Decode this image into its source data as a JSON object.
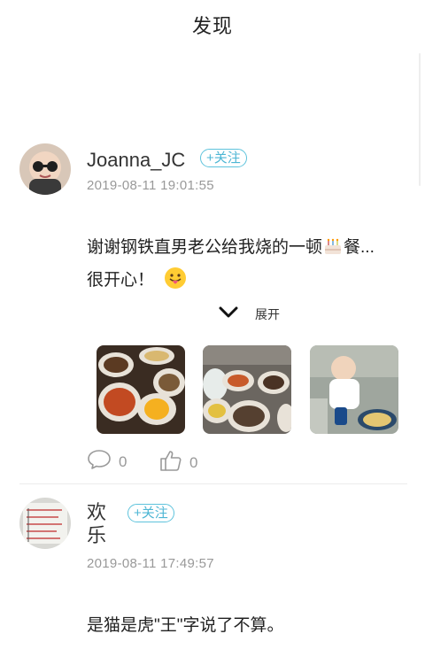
{
  "header": {
    "title": "发现"
  },
  "posts": [
    {
      "username": "Joanna_JC",
      "follow_label": "+关注",
      "timestamp": "2019-08-11 19:01:55",
      "content_line1": "谢谢钢铁直男老公给我烧的一顿",
      "content_line1_tail": "餐...",
      "content_line2": "很开心！",
      "expand_label": "展开",
      "comment_count": "0",
      "like_count": "0"
    },
    {
      "username_line1": "欢",
      "username_line2": "乐",
      "follow_label": "+关注",
      "timestamp": "2019-08-11 17:49:57",
      "content": "是猫是虎\"王\"字说了不算。"
    }
  ],
  "icons": {
    "expand": "chevron-down-icon",
    "comment": "comment-icon",
    "like": "thumbs-up-icon",
    "cake": "cake-emoji",
    "tongue": "tongue-emoji"
  },
  "colors": {
    "follow_accent": "#4db6d4",
    "secondary_text": "#999999"
  }
}
